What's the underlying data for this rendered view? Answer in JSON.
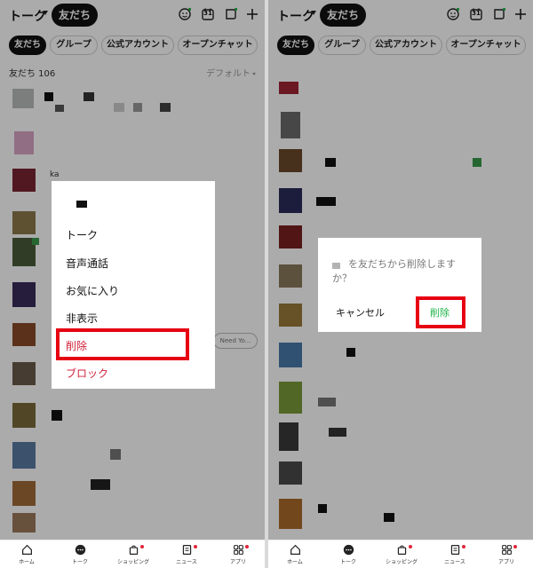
{
  "header": {
    "talk_label": "トーク",
    "friends_label": "友だち",
    "calendar_number": "31"
  },
  "tabs": [
    "友だち",
    "グループ",
    "公式アカウント",
    "オープンチャット"
  ],
  "friend_count": "友だち 106",
  "sort_label": "デフォルト",
  "list_snippets": {
    "row_name_1": "ka",
    "row_message": "Need Yo..."
  },
  "menu": {
    "items": [
      "トーク",
      "音声通話",
      "お気に入り",
      "非表示",
      "削除",
      "ブロック"
    ]
  },
  "confirm": {
    "message": "を友だちから削除しますか？",
    "cancel": "キャンセル",
    "delete": "削除"
  },
  "bottom_nav": {
    "items": [
      "ホーム",
      "トーク",
      "ショッピング",
      "ニュース",
      "アプリ"
    ]
  },
  "colors": {
    "highlight": "#e60012",
    "delete_red": "#d1213b",
    "confirm_green": "#1bb347",
    "badge_red": "#e0263c"
  }
}
